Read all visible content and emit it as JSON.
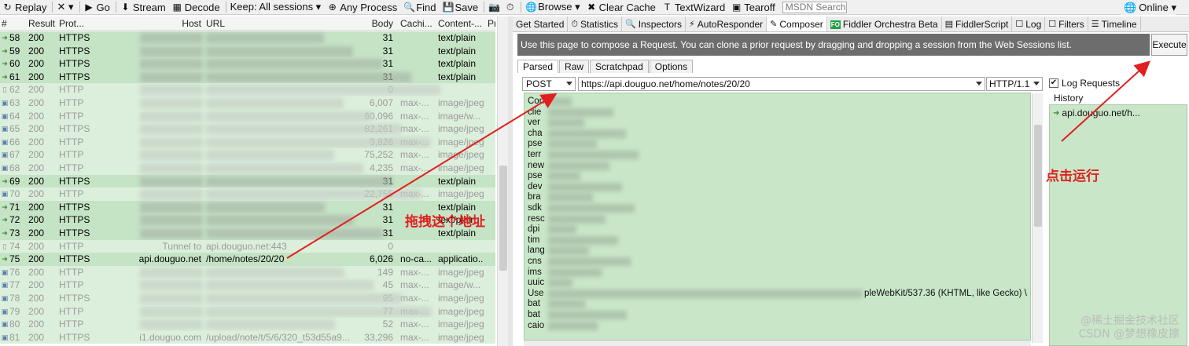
{
  "toolbar": {
    "items": [
      {
        "label": "Replay",
        "icon": "↻"
      },
      {
        "label": "✕ ▾",
        "icon": ""
      },
      {
        "label": "Go",
        "icon": "▶"
      },
      {
        "label": "Stream",
        "icon": "⬇"
      },
      {
        "label": "Decode",
        "icon": "▦"
      },
      {
        "label": "Keep: All sessions ▾",
        "icon": ""
      },
      {
        "label": "Any Process",
        "icon": "⊕"
      },
      {
        "label": "Find",
        "icon": "🔍"
      },
      {
        "label": "Save",
        "icon": "💾"
      },
      {
        "label": "",
        "icon": "📷"
      },
      {
        "label": "",
        "icon": "⏱"
      },
      {
        "label": "Browse ▾",
        "icon": "🌐"
      },
      {
        "label": "Clear Cache",
        "icon": "✖"
      },
      {
        "label": "TextWizard",
        "icon": "T"
      },
      {
        "label": "Tearoff",
        "icon": "▣"
      }
    ],
    "search_placeholder": "MSDN Search",
    "online_label": "Online ▾"
  },
  "sessions": {
    "columns": [
      "#",
      "Result",
      "Prot...",
      "Host",
      "URL",
      "Body",
      "Cachi...",
      "Content-...",
      "Pr"
    ],
    "rows": [
      {
        "num": "58",
        "result": "200",
        "prot": "HTTPS",
        "host": "",
        "url": "",
        "body": "31",
        "cache": "",
        "ctype": "text/plain",
        "state": "active",
        "icon": "ok"
      },
      {
        "num": "59",
        "result": "200",
        "prot": "HTTPS",
        "host": "",
        "url": "",
        "body": "31",
        "cache": "",
        "ctype": "text/plain",
        "state": "active",
        "icon": "ok"
      },
      {
        "num": "60",
        "result": "200",
        "prot": "HTTPS",
        "host": "",
        "url": "",
        "body": "31",
        "cache": "",
        "ctype": "text/plain",
        "state": "active",
        "icon": "ok"
      },
      {
        "num": "61",
        "result": "200",
        "prot": "HTTPS",
        "host": "",
        "url": "",
        "body": "31",
        "cache": "",
        "ctype": "text/plain",
        "state": "active",
        "icon": "ok"
      },
      {
        "num": "62",
        "result": "200",
        "prot": "HTTP",
        "host": "",
        "url": "",
        "body": "0",
        "cache": "",
        "ctype": "",
        "state": "dim",
        "icon": "txt"
      },
      {
        "num": "63",
        "result": "200",
        "prot": "HTTP",
        "host": "",
        "url": "",
        "body": "6,007",
        "cache": "max-...",
        "ctype": "image/jpeg",
        "state": "dim",
        "icon": "img"
      },
      {
        "num": "64",
        "result": "200",
        "prot": "HTTP",
        "host": "",
        "url": "",
        "body": "60,096",
        "cache": "max-...",
        "ctype": "image/w...",
        "state": "dim",
        "icon": "img"
      },
      {
        "num": "65",
        "result": "200",
        "prot": "HTTPS",
        "host": "",
        "url": "",
        "body": "82,261",
        "cache": "max-...",
        "ctype": "image/jpeg",
        "state": "dim",
        "icon": "img"
      },
      {
        "num": "66",
        "result": "200",
        "prot": "HTTP",
        "host": "",
        "url": "",
        "body": "3,826",
        "cache": "max-...",
        "ctype": "image/jpeg",
        "state": "dim",
        "icon": "img"
      },
      {
        "num": "67",
        "result": "200",
        "prot": "HTTP",
        "host": "",
        "url": "",
        "body": "75,252",
        "cache": "max-...",
        "ctype": "image/jpeg",
        "state": "dim",
        "icon": "img"
      },
      {
        "num": "68",
        "result": "200",
        "prot": "HTTP",
        "host": "",
        "url": "",
        "body": "4,235",
        "cache": "max-...",
        "ctype": "image/jpeg",
        "state": "dim",
        "icon": "img"
      },
      {
        "num": "69",
        "result": "200",
        "prot": "HTTPS",
        "host": "",
        "url": "",
        "body": "31",
        "cache": "",
        "ctype": "text/plain",
        "state": "active",
        "icon": "ok"
      },
      {
        "num": "70",
        "result": "200",
        "prot": "HTTP",
        "host": "",
        "url": "",
        "body": "22,755",
        "cache": "max-...",
        "ctype": "image/jpeg",
        "state": "dim",
        "icon": "img"
      },
      {
        "num": "71",
        "result": "200",
        "prot": "HTTPS",
        "host": "",
        "url": "",
        "body": "31",
        "cache": "",
        "ctype": "text/plain",
        "state": "active",
        "icon": "ok"
      },
      {
        "num": "72",
        "result": "200",
        "prot": "HTTPS",
        "host": "",
        "url": "",
        "body": "31",
        "cache": "",
        "ctype": "text/plain",
        "state": "active",
        "icon": "ok"
      },
      {
        "num": "73",
        "result": "200",
        "prot": "HTTPS",
        "host": "",
        "url": "",
        "body": "31",
        "cache": "",
        "ctype": "text/plain",
        "state": "active",
        "icon": "ok"
      },
      {
        "num": "74",
        "result": "200",
        "prot": "HTTP",
        "host": "Tunnel to",
        "url": "api.douguo.net:443",
        "body": "0",
        "cache": "",
        "ctype": "",
        "state": "dim",
        "icon": "txt"
      },
      {
        "num": "75",
        "result": "200",
        "prot": "HTTPS",
        "host": "api.douguo.net",
        "url": "/home/notes/20/20",
        "body": "6,026",
        "cache": "no-ca...",
        "ctype": "applicatio...",
        "state": "active",
        "icon": "ok"
      },
      {
        "num": "76",
        "result": "200",
        "prot": "HTTP",
        "host": "",
        "url": "",
        "body": "149",
        "cache": "max-...",
        "ctype": "image/jpeg",
        "state": "dim",
        "icon": "img"
      },
      {
        "num": "77",
        "result": "200",
        "prot": "HTTP",
        "host": "",
        "url": "",
        "body": "45",
        "cache": "max-...",
        "ctype": "image/w...",
        "state": "dim",
        "icon": "img"
      },
      {
        "num": "78",
        "result": "200",
        "prot": "HTTPS",
        "host": "",
        "url": "",
        "body": "95",
        "cache": "max-...",
        "ctype": "image/jpeg",
        "state": "dim",
        "icon": "img"
      },
      {
        "num": "79",
        "result": "200",
        "prot": "HTTP",
        "host": "",
        "url": "",
        "body": "77",
        "cache": "max-...",
        "ctype": "image/jpeg",
        "state": "dim",
        "icon": "img"
      },
      {
        "num": "80",
        "result": "200",
        "prot": "HTTP",
        "host": "",
        "url": "",
        "body": "52",
        "cache": "max-...",
        "ctype": "image/jpeg",
        "state": "dim",
        "icon": "img"
      },
      {
        "num": "81",
        "result": "200",
        "prot": "HTTPS",
        "host": "i1.douguo.com",
        "url": "/upload/note/t/5/6/320_t53d55a9...",
        "body": "33,296",
        "cache": "max-...",
        "ctype": "image/jpeg",
        "state": "dim",
        "icon": "img"
      }
    ]
  },
  "inspector_tabs": [
    {
      "label": "Get Started",
      "icon": ""
    },
    {
      "label": "Statistics",
      "icon": "⏱"
    },
    {
      "label": "Inspectors",
      "icon": "🔍"
    },
    {
      "label": "AutoResponder",
      "icon": "⚡"
    },
    {
      "label": "Composer",
      "icon": "✎",
      "active": true
    },
    {
      "label": "Fiddler Orchestra Beta",
      "icon": "FO"
    },
    {
      "label": "FiddlerScript",
      "icon": "▤"
    },
    {
      "label": "Log",
      "icon": "☐"
    },
    {
      "label": "Filters",
      "icon": "☐"
    },
    {
      "label": "Timeline",
      "icon": "☰"
    }
  ],
  "composer": {
    "info_text": "Use this page to compose a Request. You can clone a prior request by dragging and dropping a session from the Web Sessions list.",
    "execute_label": "Execute",
    "subtabs": [
      "Parsed",
      "Raw",
      "Scratchpad",
      "Options"
    ],
    "method": "POST",
    "url": "https://api.douguo.net/home/notes/20/20",
    "http_version": "HTTP/1.1",
    "header_prefixes": [
      "Con",
      "clie",
      "ver",
      "cha",
      "pse",
      "terr",
      "new",
      "pse",
      "dev",
      "bra",
      "sdk",
      "resc",
      "dpi",
      "tim",
      "lang",
      "cns",
      "ims",
      "uuic",
      "Use",
      "bat",
      "bat",
      "caio"
    ],
    "user_agent_tail": "pleWebKit/537.36 (KHTML, like Gecko) \\",
    "log_requests_label": "Log Requests",
    "log_requests_checked": true,
    "history_label": "History",
    "history_items": [
      "api.douguo.net/h..."
    ]
  },
  "annotations": {
    "drag_note": "拖拽这个地址",
    "execute_note": "点击运行",
    "color": "#e02020"
  },
  "watermark": {
    "line1": "@稀土掘金技术社区",
    "line2": "CSDN @梦想橡皮擦"
  }
}
